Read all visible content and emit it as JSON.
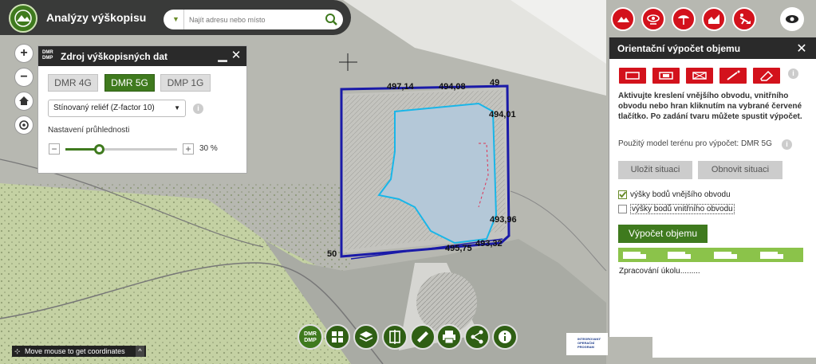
{
  "app": {
    "title": "Analýzy výškopisu"
  },
  "search": {
    "placeholder": "Najít adresu nebo místo"
  },
  "dmr_panel": {
    "icon_text_top": "DMR",
    "icon_text_bottom": "DMP",
    "title": "Zdroj výškopisných dat",
    "buttons": [
      {
        "label": "DMR 4G"
      },
      {
        "label": "DMR 5G"
      },
      {
        "label": "DMP 1G"
      }
    ],
    "active": "DMR 5G",
    "relief_select": "Stínovaný reliéf (Z-factor 10)",
    "transparency_label": "Nastavení průhlednosti",
    "transparency_value": "30 %",
    "transparency_fraction": 0.3
  },
  "volume_panel": {
    "title": "Orientační výpočet objemu",
    "description": "Aktivujte kreslení vnějšího obvodu, vnitřního obvodu nebo hran kliknutím na vybrané červené tlačítko. Po zadání tvaru můžete spustit výpočet.",
    "model_text": "Použitý model terénu pro výpočet: DMR 5G",
    "save_label": "Uložit situaci",
    "restore_label": "Obnovit situaci",
    "check_outer": "výšky bodů vnějšího obvodu",
    "check_outer_checked": true,
    "check_inner": "výšky bodů vnitřního obvodu",
    "check_inner_checked": false,
    "calc_label": "Výpočet objemu",
    "status": "Zpracování úkolu........."
  },
  "coords": {
    "text": "Move mouse to get coordinates"
  },
  "bottom_toolbar": {
    "dmr_top": "DMR",
    "dmr_bottom": "DMP"
  },
  "partner_logo": {
    "line1": "INTEGROVANÝ",
    "line2": "OPERAČNÍ",
    "line3": "PROGRAM"
  },
  "map_labels": [
    {
      "text": "497,14"
    },
    {
      "text": "494,08"
    },
    {
      "text": "49"
    },
    {
      "text": "494,01"
    },
    {
      "text": "493,96"
    },
    {
      "text": "493,32"
    },
    {
      "text": "495,75"
    },
    {
      "text": "50"
    }
  ],
  "colors": {
    "accent_green": "#3f7a1e",
    "tool_red": "#d3121c",
    "outline_blue": "#1a1aa8",
    "water_cyan": "#19b6e8"
  }
}
